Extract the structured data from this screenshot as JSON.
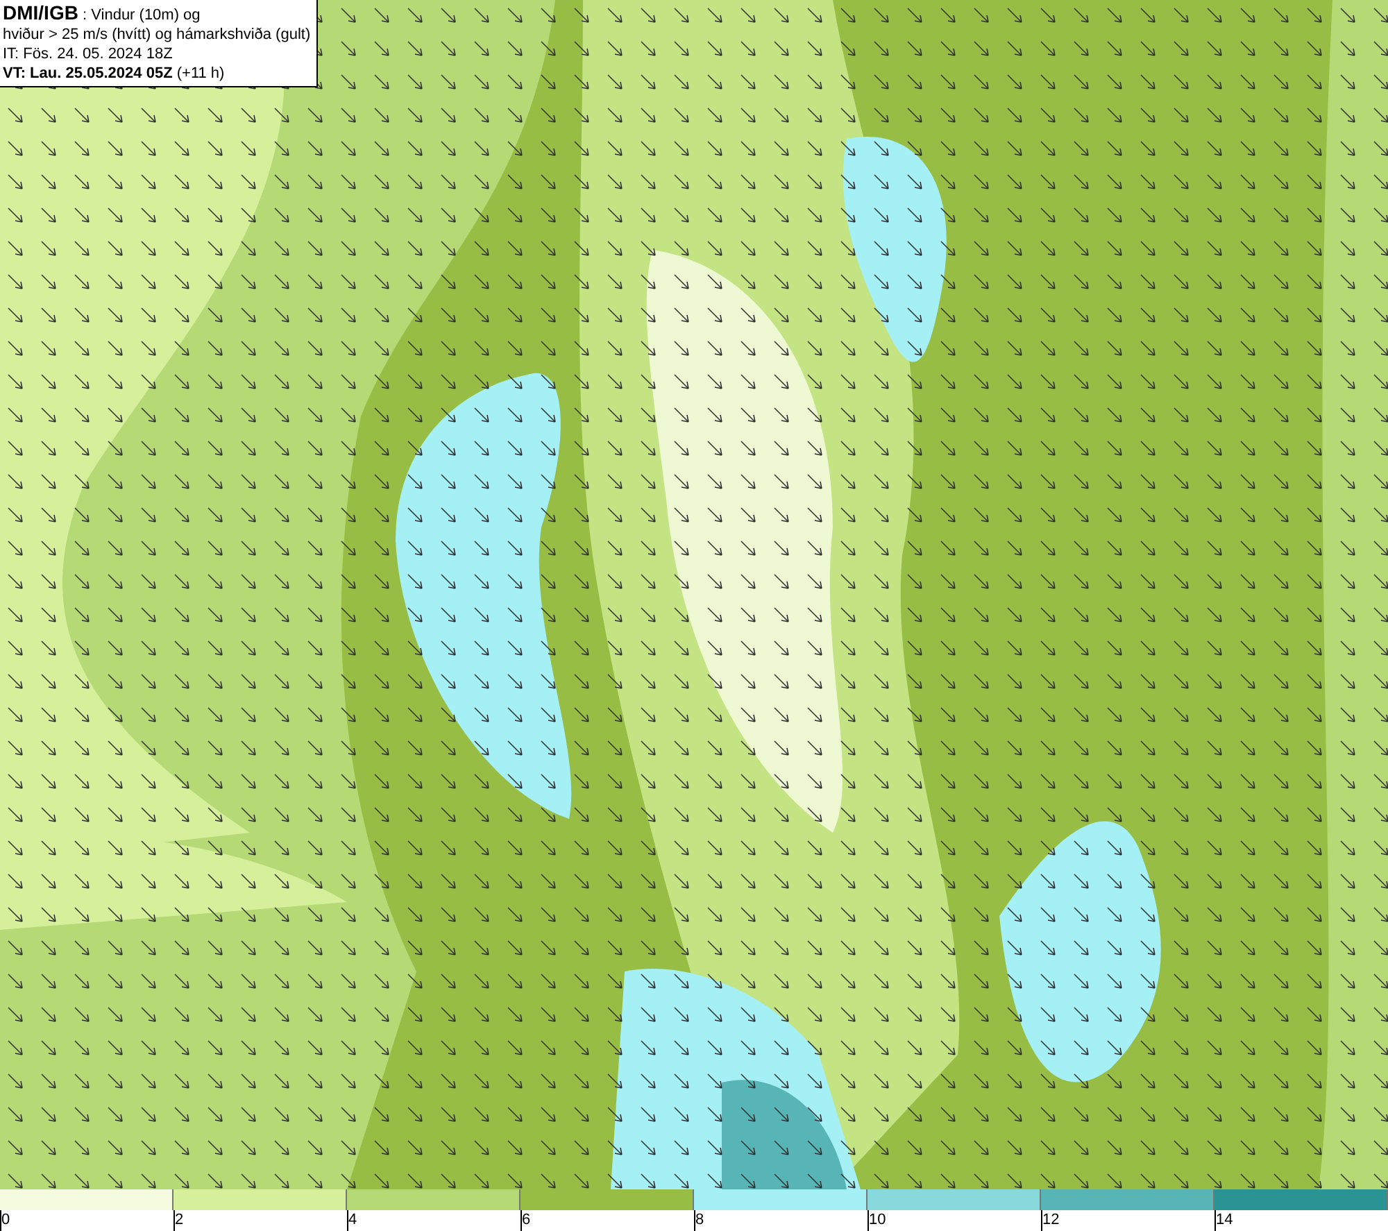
{
  "title_box": {
    "lines": [
      "**DMI/IGB** : Vindur (10m) og",
      "hviður > 25 m/s (hvítt) og hámarkshviða (gult)",
      "IT: Fös. 24. 05. 2024 18Z",
      "**VT: Lau. 25.05.2024 05Z** (+11 h)"
    ]
  },
  "legend": {
    "segments": [
      {
        "color": "#f4fbdf"
      },
      {
        "color": "#d6ef9b"
      },
      {
        "color": "#b5d974"
      },
      {
        "color": "#98bd45"
      },
      {
        "color": "#a4f0f4"
      },
      {
        "color": "#88d9dc"
      },
      {
        "color": "#58b5b5"
      },
      {
        "color": "#2a9393"
      }
    ],
    "ticks": [
      "0",
      "2",
      "4",
      "6",
      "8",
      "10",
      "12",
      "14"
    ]
  }
}
